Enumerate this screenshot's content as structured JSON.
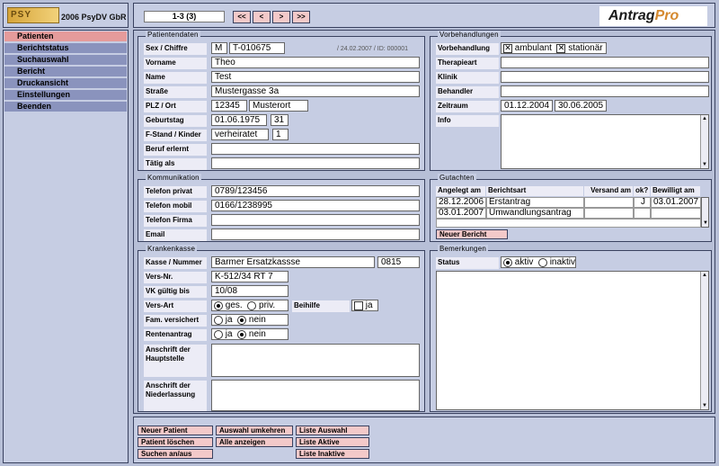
{
  "logo": {
    "mark": "PSY",
    "company": "2006 PsyDV GbR"
  },
  "nav": {
    "items": [
      "Patienten",
      "Berichtstatus",
      "Suchauswahl",
      "Bericht",
      "Druckansicht",
      "Einstellungen",
      "Beenden"
    ]
  },
  "topbar": {
    "record": "1-3 (3)",
    "first": "<<",
    "prev": "<",
    "next": ">",
    "last": ">>",
    "brand_a": "Antrag",
    "brand_b": "Pro"
  },
  "patient": {
    "title": "Patientendaten",
    "sex_label": "Sex / Chiffre",
    "sex": "M",
    "chiffre": "T-010675",
    "meta": "/ 24.02.2007 / ID: 000001",
    "vorname_label": "Vorname",
    "vorname": "Theo",
    "name_label": "Name",
    "name": "Test",
    "strasse_label": "Straße",
    "strasse": "Mustergasse 3a",
    "plz_label": "PLZ / Ort",
    "plz": "12345",
    "ort": "Musterort",
    "geb_label": "Geburtstag",
    "geb": "01.06.1975",
    "alter": "31",
    "fstand_label": "F-Stand / Kinder",
    "fstand": "verheiratet",
    "kinder": "1",
    "beruf_label": "Beruf erlernt",
    "beruf": "",
    "taetig_label": "Tätig als",
    "taetig": ""
  },
  "vorbehandlungen": {
    "title": "Vorbehandlungen",
    "vb_label": "Vorbehandlung",
    "ambulant": "ambulant",
    "stationaer": "stationär",
    "therapie_label": "Therapieart",
    "klinik_label": "Klinik",
    "behandler_label": "Behandler",
    "zeitraum_label": "Zeitraum",
    "von": "01.12.2004",
    "bis": "30.06.2005",
    "info_label": "Info"
  },
  "kommunikation": {
    "title": "Kommunikation",
    "privat_label": "Telefon privat",
    "privat": "0789/123456",
    "mobil_label": "Telefon mobil",
    "mobil": "0166/1238995",
    "firma_label": "Telefon Firma",
    "firma": "",
    "email_label": "Email",
    "email": ""
  },
  "gutachten": {
    "title": "Gutachten",
    "headers": [
      "Angelegt am",
      "Berichtsart",
      "Versand am",
      "ok?",
      "Bewilligt am"
    ],
    "rows": [
      [
        "28.12.2006",
        "Erstantrag",
        "",
        "J",
        "03.01.2007"
      ],
      [
        "03.01.2007",
        "Umwandlungsantrag",
        "",
        "",
        ""
      ]
    ],
    "new_button": "Neuer Bericht"
  },
  "krankenkasse": {
    "title": "Krankenkasse",
    "kasse_label": "Kasse / Nummer",
    "kasse": "Barmer Ersatzkassse",
    "nummer": "0815",
    "versnr_label": "Vers-Nr.",
    "versnr": "K-512/34 RT 7",
    "vk_label": "VK gültig bis",
    "vk": "10/08",
    "versart_label": "Vers-Art",
    "ges": "ges.",
    "priv": "priv.",
    "beihilfe_label": "Beihilfe",
    "beihilfe": "ja",
    "famvers_label": "Fam. versichert",
    "ja": "ja",
    "nein": "nein",
    "rente_label": "Rentenantrag",
    "haupt_label": "Anschrift der Hauptstelle",
    "nieder_label": "Anschrift der Niederlassung"
  },
  "bemerkungen": {
    "title": "Bemerkungen",
    "status_label": "Status",
    "aktiv": "aktiv",
    "inaktiv": "inaktiv"
  },
  "footer": {
    "buttons_col1": [
      "Neuer Patient",
      "Patient löschen",
      "Suchen an/aus"
    ],
    "buttons_col2": [
      "Auswahl umkehren",
      "Alle anzeigen"
    ],
    "buttons_col3": [
      "Liste Auswahl",
      "Liste Aktive",
      "Liste Inaktive"
    ]
  }
}
